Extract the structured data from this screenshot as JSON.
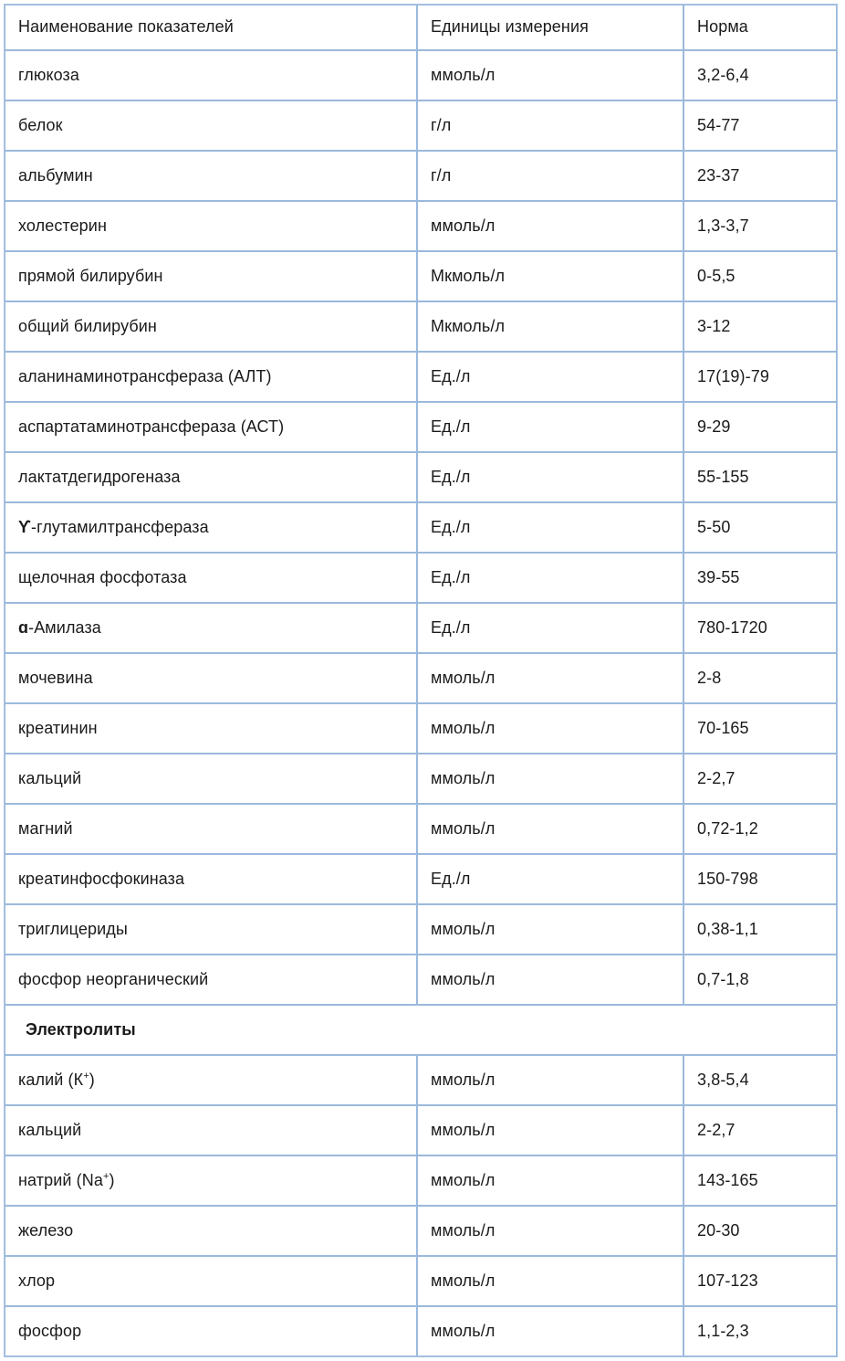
{
  "table": {
    "headers": [
      "Наименование показателей",
      "Единицы измерения",
      "Норма"
    ],
    "colors": {
      "border": "#9bb9dc",
      "outer_border": "#a8c4e0",
      "cell_background": "#ffffff",
      "text": "#1a1a1a"
    },
    "rows": [
      {
        "type": "data",
        "name": "глюкоза",
        "units": "ммоль/л",
        "norm": "3,2-6,4"
      },
      {
        "type": "data",
        "name": "белок",
        "units": "г/л",
        "norm": "54-77"
      },
      {
        "type": "data",
        "name": "альбумин",
        "units": "г/л",
        "norm": "23-37"
      },
      {
        "type": "data",
        "name": "холестерин",
        "units": "ммоль/л",
        "norm": "1,3-3,7"
      },
      {
        "type": "data",
        "name": "прямой билирубин",
        "units": "Мкмоль/л",
        "norm": "0-5,5"
      },
      {
        "type": "data",
        "name": "общий билирубин",
        "units": "Мкмоль/л",
        "norm": "3-12"
      },
      {
        "type": "data",
        "name": "аланинаминотрансфераза (АЛТ)",
        "units": "Ед./л",
        "norm": "17(19)-79"
      },
      {
        "type": "data",
        "name": "аспартатаминотрансфераза (АСТ)",
        "units": "Ед./л",
        "norm": "9-29"
      },
      {
        "type": "data",
        "name": "лактатдегидрогеназа",
        "units": "Ед./л",
        "norm": "55-155"
      },
      {
        "type": "data",
        "name": "ϒ-глутамилтрансфераза",
        "units": "Ед./л",
        "norm": "5-50"
      },
      {
        "type": "data",
        "name": "щелочная фосфотаза",
        "units": "Ед./л",
        "norm": "39-55"
      },
      {
        "type": "data",
        "name": "ɑ-Амилаза",
        "units": "Ед./л",
        "norm": "780-1720"
      },
      {
        "type": "data",
        "name": "мочевина",
        "units": "ммоль/л",
        "norm": "2-8"
      },
      {
        "type": "data",
        "name": "креатинин",
        "units": "ммоль/л",
        "norm": "70-165"
      },
      {
        "type": "data",
        "name": "кальций",
        "units": "ммоль/л",
        "norm": "2-2,7"
      },
      {
        "type": "data",
        "name": "магний",
        "units": "ммоль/л",
        "norm": "0,72-1,2"
      },
      {
        "type": "data",
        "name": "креатинфосфокиназа",
        "units": "Ед./л",
        "norm": "150-798"
      },
      {
        "type": "data",
        "name": "триглицериды",
        "units": "ммоль/л",
        "norm": "0,38-1,1"
      },
      {
        "type": "data",
        "name": "фосфор неорганический",
        "units": "ммоль/л",
        "norm": "0,7-1,8"
      },
      {
        "type": "section",
        "name": "Электролиты"
      },
      {
        "type": "data",
        "name": "калий (К⁺)",
        "units": "ммоль/л",
        "norm": "3,8-5,4"
      },
      {
        "type": "data",
        "name": "кальций",
        "units": "ммоль/л",
        "norm": "2-2,7"
      },
      {
        "type": "data",
        "name": "натрий (Na⁺)",
        "units": "ммоль/л",
        "norm": "143-165"
      },
      {
        "type": "data",
        "name": "железо",
        "units": "ммоль/л",
        "norm": "20-30"
      },
      {
        "type": "data",
        "name": "хлор",
        "units": "ммоль/л",
        "norm": "107-123"
      },
      {
        "type": "data",
        "name": "фосфор",
        "units": "ммоль/л",
        "norm": "1,1-2,3"
      }
    ]
  }
}
